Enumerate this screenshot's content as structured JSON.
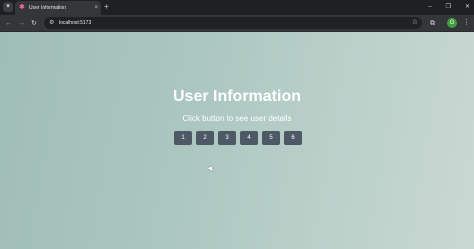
{
  "browser": {
    "tab": {
      "title": "User Information",
      "close_icon": "×",
      "favicon": "react-logo-icon"
    },
    "new_tab_label": "+",
    "window_controls": {
      "minimize": "–",
      "maximize": "❐",
      "close": "✕"
    },
    "address_bar": {
      "url": "localhost:5173"
    },
    "profile_initial": "G"
  },
  "page": {
    "title": "User Information",
    "subtitle": "Click button to see user details",
    "buttons": [
      "1",
      "2",
      "3",
      "4",
      "5",
      "6"
    ]
  },
  "colors": {
    "button_bg": "#4d5a66",
    "page_gradient_start": "#9fbdb7",
    "page_gradient_end": "#c9d8d2"
  }
}
